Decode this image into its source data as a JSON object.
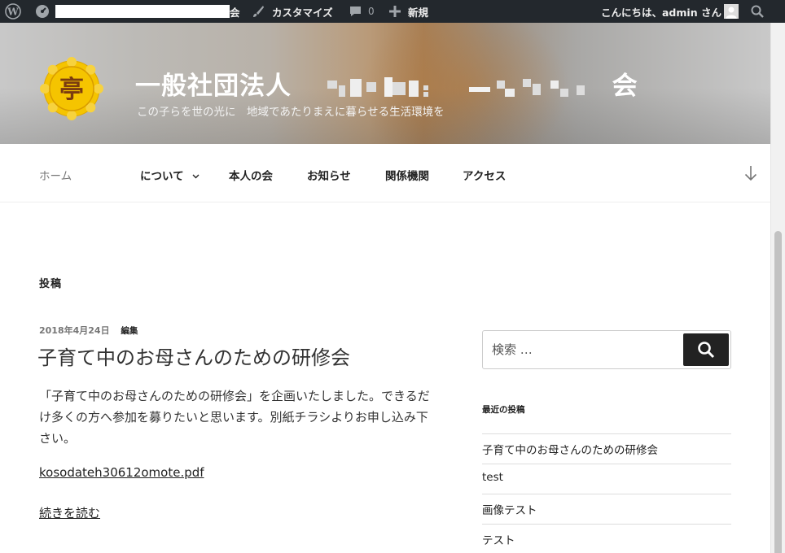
{
  "adminbar": {
    "site_name_suffix": "会",
    "customize_label": "カスタマイズ",
    "comment_count": "0",
    "new_label": "新規",
    "greeting": "こんにちは、admin さん"
  },
  "header": {
    "title_prefix": "一般社団法人",
    "title_suffix": "会",
    "tagline": "この子らを世の光に　地域であたりまえに暮らせる生活環境を",
    "logo_glyph": "亭"
  },
  "nav": {
    "items": [
      {
        "label": "ホーム"
      },
      {
        "label": "について"
      },
      {
        "label": "本人の会"
      },
      {
        "label": "お知らせ"
      },
      {
        "label": "関係機関"
      },
      {
        "label": "アクセス"
      }
    ]
  },
  "main": {
    "page_heading": "投稿",
    "post": {
      "date": "2018年4月24日",
      "edit_label": "編集",
      "title": "子育て中のお母さんのための研修会",
      "body": "「子育て中のお母さんのための研修会」を企画いたしました。できるだけ多くの方へ参加を募りたいと思います。別紙チラシよりお申し込み下さい。",
      "attachment": "kosodateh30612omote.pdf",
      "read_more": "続きを読む"
    }
  },
  "sidebar": {
    "search_placeholder": "検索 …",
    "recent_title": "最近の投稿",
    "recent_posts": [
      "子育て中のお母さんのための研修会",
      "test",
      "画像テスト",
      "テスト"
    ]
  },
  "colors": {
    "admin_bar": "#23282d",
    "logo_yellow": "#f5c400",
    "search_button": "#222222"
  }
}
